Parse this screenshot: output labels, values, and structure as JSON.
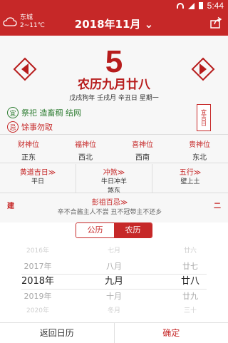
{
  "status_bar": {
    "time": "5:44"
  },
  "header": {
    "location": "东城",
    "temperature": "2~11℃",
    "title": "2018年11月",
    "title_arrow": "⌄"
  },
  "calendar": {
    "day_number": "5",
    "lunar_date": "农历九月廿八",
    "ganzhi": "戊戌狗年 壬戌月 辛丑日 星期一",
    "yi": {
      "mark": "宜",
      "text": "祭祀 造畜稠 结网"
    },
    "ji": {
      "mark": "忌",
      "text": "馀事勿取"
    },
    "stamp": "宜吉日"
  },
  "gods": [
    {
      "title": "财神位",
      "value": "正东"
    },
    {
      "title": "福神位",
      "value": "西北"
    },
    {
      "title": "喜神位",
      "value": "西南"
    },
    {
      "title": "贵神位",
      "value": "东北"
    }
  ],
  "info": [
    {
      "title": "黄道吉日≫",
      "value": "平日",
      "value2": ""
    },
    {
      "title": "冲煞≫",
      "value": "牛日冲羊",
      "value2": "煞东"
    },
    {
      "title": "五行≫",
      "value": "壁上土",
      "value2": ""
    }
  ],
  "pengzu": {
    "left": "建",
    "title": "彭祖百忌≫",
    "body": "辛不合酱主人不尝 丑不冠带主不还乡",
    "right": "二"
  },
  "picker": {
    "toggle_solar": "公历",
    "toggle_lunar": "农历",
    "years": [
      "2016年",
      "2017年",
      "2018年",
      "2019年",
      "2020年"
    ],
    "months": [
      "七月",
      "八月",
      "九月",
      "十月",
      "冬月"
    ],
    "days": [
      "廿六",
      "廿七",
      "廿八",
      "廿九",
      "三十"
    ]
  },
  "footer": {
    "back": "返回日历",
    "confirm": "确定"
  },
  "colors": {
    "accent": "#c62828",
    "yi": "#2e7d32"
  }
}
